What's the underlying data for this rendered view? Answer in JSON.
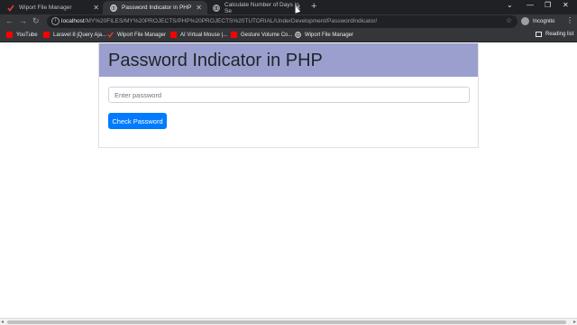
{
  "browser": {
    "tabs": [
      {
        "title": "Wiport File Manager",
        "icon": "wiport-check-icon",
        "active": false
      },
      {
        "title": "Password Indicator in PHP",
        "icon": "globe-icon",
        "active": true
      },
      {
        "title": "Calculate Number of Days in Se",
        "icon": "globe-icon",
        "active": false
      }
    ],
    "new_tab_label": "+",
    "url_host": "localhost",
    "url_path": "/MY%20FILES/MY%20PROJECTS/PHP%20PROJECTS%20TUTORIAL/UnderDevelopment/PasswordIndicator/",
    "profile_label": "Incognito",
    "bookmarks": [
      {
        "label": "YouTube",
        "icon": "youtube-icon",
        "color": "#ff0000"
      },
      {
        "label": "Laravel 8 jQuery Aja...",
        "icon": "youtube-icon",
        "color": "#ff0000"
      },
      {
        "label": "Wiport File Manager",
        "icon": "wiport-check-icon",
        "color": "#e53935"
      },
      {
        "label": "AI Virtual Mouse |...",
        "icon": "youtube-icon",
        "color": "#ff0000"
      },
      {
        "label": "Gesture Volume Co...",
        "icon": "youtube-icon",
        "color": "#ff0000"
      },
      {
        "label": "Wiport File Manager",
        "icon": "globe-icon",
        "color": "#9aa0a6"
      }
    ],
    "reading_list_label": "Reading list"
  },
  "page": {
    "title": "Password Indicator in PHP",
    "password_placeholder": "Enter password",
    "check_button_label": "Check Password",
    "header_color": "#9b9fcd",
    "button_color": "#007bff"
  }
}
